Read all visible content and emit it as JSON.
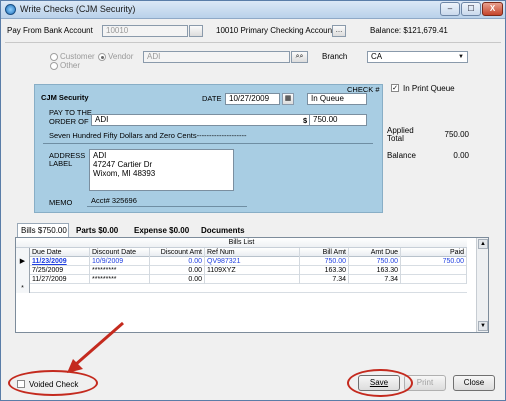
{
  "window": {
    "title": "Write Checks  (CJM Security)",
    "controls": [
      "–",
      "☐",
      "X"
    ]
  },
  "header": {
    "pay_from_label": "Pay From Bank Account",
    "bank_code": "10010",
    "bank_name": "10010 Primary Checking Account*",
    "balance_label": "Balance:",
    "balance_value": "$121,679.41"
  },
  "payee": {
    "customer_label": "Customer",
    "vendor_label": "Vendor",
    "other_label": "Other",
    "selected": "Vendor",
    "name": "ADI",
    "branch_label": "Branch",
    "branch_value": "CA"
  },
  "check": {
    "company": "CJM Security",
    "check_no_label": "CHECK #",
    "check_no_value": "In Queue",
    "date_label": "DATE",
    "date_value": "10/27/2009",
    "pay_to_label_1": "PAY TO THE",
    "pay_to_label_2": "ORDER OF",
    "pay_to_value": "ADI",
    "dollar_sign": "$",
    "amount": "750.00",
    "amount_words": "Seven Hundred Fifty Dollars and Zero Cents--------------------",
    "address_label_1": "ADDRESS",
    "address_label_2": "LABEL",
    "address_lines": [
      "ADI",
      "47247 Cartier Dr",
      "Wixom, MI  48393"
    ],
    "memo_label": "MEMO",
    "memo_value": "Acct# 325696"
  },
  "side": {
    "print_queue_label": "In Print Queue",
    "print_queue_checked": true,
    "applied_total_label_1": "Applied",
    "applied_total_label_2": "Total",
    "applied_total_value": "750.00",
    "balance_label": "Balance",
    "balance_value": "0.00"
  },
  "tabs": [
    {
      "label": "Bills  $750.00",
      "active": true
    },
    {
      "label": "Parts  $0.00",
      "active": false
    },
    {
      "label": "Expense  $0.00",
      "active": false
    },
    {
      "label": "Documents",
      "active": false
    }
  ],
  "grid": {
    "title": "Bills List",
    "columns": [
      "Due Date",
      "Discount Date",
      "Discount Amt",
      "Ref Num",
      "Bill Amt",
      "Amt Due",
      "Paid"
    ],
    "rows": [
      {
        "due": "11/23/2009",
        "disc_date": "10/9/2009",
        "disc_amt": "0.00",
        "ref": "QV987321",
        "bill_amt": "750.00",
        "amt_due": "750.00",
        "paid": "750.00"
      },
      {
        "due": "7/25/2009",
        "disc_date": "*********",
        "disc_amt": "0.00",
        "ref": "1109XYZ",
        "bill_amt": "163.30",
        "amt_due": "163.30",
        "paid": ""
      },
      {
        "due": "11/27/2009",
        "disc_date": "*********",
        "disc_amt": "0.00",
        "ref": "",
        "bill_amt": "7.34",
        "amt_due": "7.34",
        "paid": ""
      }
    ],
    "new_row_marker": "*",
    "current_row_marker": "▶"
  },
  "footer": {
    "voided_label": "Voided Check",
    "voided_checked": false,
    "save_label": "Save",
    "print_label": "Print",
    "close_label": "Close"
  },
  "annotation_color": "#c42a1e"
}
